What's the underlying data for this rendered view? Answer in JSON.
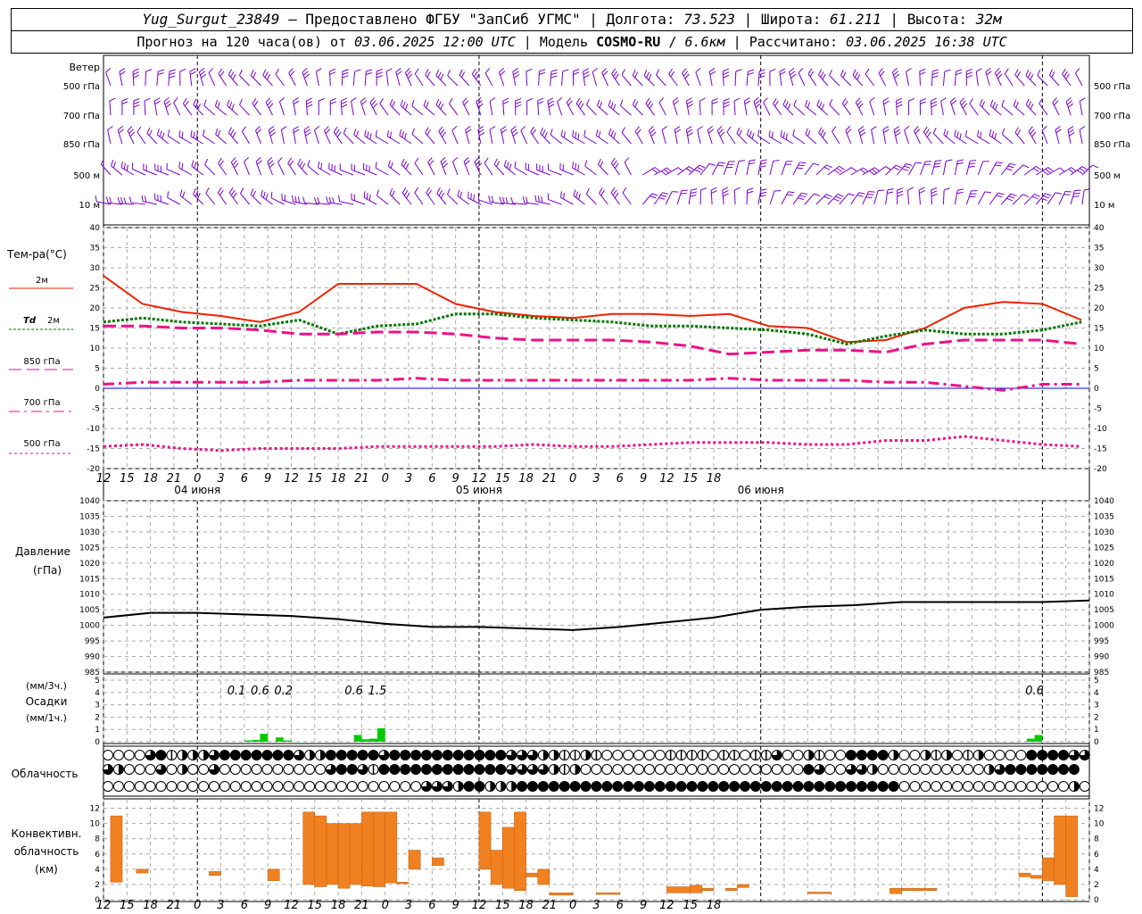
{
  "header": {
    "station": "Yug_Surgut_23849",
    "provider": "Предоставлено ФГБУ \"ЗапСиб УГМС\"",
    "lon_label": "Долгота:",
    "lon_value": "73.523",
    "lat_label": "Широта:",
    "lat_value": "61.211",
    "alt_label": "Высота:",
    "alt_value": "32м",
    "forecast_prefix": "Прогноз на 120 часа(ов) от",
    "forecast_start": "03.06.2025 12:00 UTC",
    "model_label": "Модель",
    "model_name": "COSMO-RU",
    "model_res": "6.6км",
    "computed_label": "Рассчитано:",
    "computed_value": "03.06.2025 16:38 UTC"
  },
  "time_axis": {
    "hour_labels": [
      "12",
      "15",
      "18",
      "21",
      "0",
      "3",
      "6",
      "9",
      "12",
      "15",
      "18",
      "21",
      "0",
      "3",
      "6",
      "9",
      "12",
      "15",
      "18",
      "21",
      "0",
      "3",
      "6",
      "9",
      "12",
      "15",
      "18"
    ],
    "date_labels": [
      "04 июня",
      "05 июня",
      "06 июня"
    ],
    "step_hours": 1
  },
  "labels": {
    "wind_title": "Ветер",
    "wind_levels": [
      "500 гПа",
      "700 гПа",
      "850 гПа",
      "500  м",
      "10   м"
    ],
    "temp_title": "Тем-ра(°C)",
    "legend_2m": "2м",
    "legend_td": "Td",
    "legend_td_2m": "2м",
    "legend_850": "850 гПа",
    "legend_700": "700 гПа",
    "legend_500": "500 гПа",
    "pressure_title": "Давление",
    "pressure_unit": "(гПа)",
    "precip_unit_3h": "(мм/3ч.)",
    "precip_title": "Осадки",
    "precip_unit_1h": "(мм/1ч.)",
    "cloud_title": "Облачность",
    "conv_title_1": "Конвективн.",
    "conv_title_2": "облачность",
    "conv_unit": "(км)"
  },
  "colors": {
    "wind": "#7700cc",
    "t2m": "#ee2200",
    "td2m": "#007700",
    "t_upper": "#ee1188",
    "pressure": "#000000",
    "precip": "#00cc00",
    "conv": "#f08020",
    "grid": "#aaaaaa",
    "zero_line": "#0000ff"
  },
  "chart_data": [
    {
      "type": "line",
      "name": "temperature",
      "x_hours": [
        0,
        3,
        6,
        9,
        12,
        15,
        18,
        21,
        24,
        27,
        30,
        33,
        36,
        39,
        42,
        45,
        48,
        51,
        54,
        57,
        60,
        63,
        66,
        69,
        72,
        75,
        78,
        81,
        84,
        87,
        90,
        93,
        96,
        99,
        102,
        105,
        108,
        111,
        114,
        117,
        120
      ],
      "ylim": [
        -20,
        40
      ],
      "yticks": [
        -20,
        -15,
        -10,
        -5,
        0,
        5,
        10,
        15,
        20,
        25,
        30,
        35,
        40
      ],
      "series": [
        {
          "name": "2м",
          "values": [
            28,
            21,
            19,
            18,
            16.5,
            19,
            26,
            26,
            26,
            21,
            19,
            18,
            17.5,
            18.5,
            18.5,
            18,
            18.5,
            15.5,
            15,
            11.5,
            12,
            15,
            20,
            21.5,
            21,
            17
          ]
        },
        {
          "name": "Td 2м",
          "values": [
            16.5,
            17.5,
            16.5,
            16,
            15.5,
            17,
            13.5,
            15.5,
            16,
            18.5,
            18.5,
            17.5,
            17,
            16.5,
            15.5,
            15.5,
            15,
            14.5,
            13.5,
            11,
            13,
            14.5,
            13.5,
            13.5,
            14.5,
            16.5
          ]
        },
        {
          "name": "850 гПа",
          "values": [
            15.5,
            15.5,
            15,
            15,
            14.5,
            13.5,
            13.5,
            14,
            14,
            13.5,
            12.5,
            12,
            12,
            12,
            11.5,
            10.5,
            8.5,
            9,
            9.5,
            9.5,
            9,
            11,
            12,
            12,
            12,
            11
          ]
        },
        {
          "name": "700 гПа",
          "values": [
            1,
            1.5,
            1.5,
            1.5,
            1.5,
            2,
            2,
            2,
            2.5,
            2,
            2,
            2,
            2,
            2,
            2,
            2,
            2.5,
            2,
            2,
            2,
            1.5,
            1.5,
            0.5,
            -0.5,
            1,
            1
          ]
        },
        {
          "name": "500 гПа",
          "values": [
            -14.5,
            -14,
            -15,
            -15.5,
            -15,
            -15,
            -15,
            -14.5,
            -14.5,
            -14.5,
            -14.5,
            -14,
            -14.5,
            -14.5,
            -14,
            -13.5,
            -13.5,
            -13.5,
            -14,
            -14,
            -13,
            -13,
            -12,
            -13,
            -14,
            -14.5
          ]
        }
      ],
      "x_series_hours": [
        0,
        5,
        10,
        15,
        20,
        25,
        30,
        35,
        40,
        45,
        50,
        55,
        60,
        65,
        70,
        75,
        80,
        85,
        90,
        95,
        100,
        105,
        110,
        115,
        120,
        125
      ]
    },
    {
      "type": "line",
      "name": "pressure",
      "ylim": [
        985,
        1040
      ],
      "yticks": [
        985,
        990,
        995,
        1000,
        1005,
        1010,
        1015,
        1020,
        1025,
        1030,
        1035,
        1040
      ],
      "x_hours": [
        0,
        6,
        12,
        18,
        24,
        30,
        36,
        42,
        48,
        54,
        60,
        66,
        72,
        78,
        84,
        90,
        96,
        102,
        108,
        114,
        120,
        126
      ],
      "values": [
        1002.5,
        1004,
        1004,
        1003.5,
        1003,
        1002,
        1000.5,
        999.5,
        999.5,
        999,
        998.5,
        999.5,
        1001,
        1002.5,
        1005,
        1006,
        1006.5,
        1007.5,
        1007.5,
        1007.5,
        1007.5,
        1008
      ]
    },
    {
      "type": "bar",
      "name": "precipitation",
      "ylim": [
        0,
        5
      ],
      "yticks": [
        0,
        1,
        2,
        3,
        4,
        5
      ],
      "bars_1h": [
        {
          "hour": 18,
          "value": 0.1
        },
        {
          "hour": 19,
          "value": 0.15
        },
        {
          "hour": 20,
          "value": 0.65
        },
        {
          "hour": 22,
          "value": 0.35
        },
        {
          "hour": 23,
          "value": 0.1
        },
        {
          "hour": 32,
          "value": 0.55
        },
        {
          "hour": 33,
          "value": 0.2
        },
        {
          "hour": 34,
          "value": 0.25
        },
        {
          "hour": 35,
          "value": 1.1
        },
        {
          "hour": 118,
          "value": 0.25
        },
        {
          "hour": 119,
          "value": 0.55
        }
      ],
      "labels_3h": [
        {
          "hour": 17,
          "text": "0.1"
        },
        {
          "hour": 20,
          "text": "0.6"
        },
        {
          "hour": 23,
          "text": "0.2"
        },
        {
          "hour": 32,
          "text": "0.6"
        },
        {
          "hour": 35,
          "text": "1.5"
        },
        {
          "hour": 119,
          "text": "0.6"
        }
      ]
    },
    {
      "type": "table",
      "name": "cloudiness",
      "rows": [
        "upper",
        "middle",
        "lower"
      ],
      "cover_0_to_4": {
        "upper": [
          0,
          0,
          0,
          0,
          3,
          4,
          1,
          2,
          2,
          2,
          3,
          4,
          4,
          4,
          4,
          4,
          4,
          4,
          3,
          2,
          2,
          4,
          4,
          4,
          4,
          4,
          3,
          4,
          4,
          4,
          4,
          4,
          4,
          4,
          4,
          4,
          4,
          4,
          3,
          3,
          3,
          2,
          2,
          1,
          1,
          2,
          1,
          0,
          0,
          0,
          0,
          0,
          0,
          1,
          1,
          1,
          1,
          0,
          1,
          1,
          0,
          1,
          1,
          3,
          0,
          0,
          2,
          1,
          0,
          0,
          4,
          4,
          4,
          4,
          2,
          0,
          0,
          2,
          1,
          2,
          0,
          1,
          2,
          0,
          0,
          0,
          0,
          4,
          4,
          4,
          4,
          3,
          3
        ],
        "middle": [
          3,
          2,
          0,
          0,
          0,
          3,
          0,
          2,
          0,
          0,
          3,
          0,
          0,
          0,
          0,
          0,
          0,
          0,
          0,
          0,
          0,
          3,
          4,
          4,
          3,
          1,
          4,
          4,
          4,
          4,
          4,
          4,
          4,
          4,
          4,
          4,
          4,
          4,
          3,
          3,
          3,
          3,
          2,
          1,
          2,
          0,
          0,
          0,
          0,
          0,
          0,
          0,
          0,
          0,
          0,
          0,
          0,
          0,
          0,
          0,
          0,
          0,
          0,
          0,
          0,
          0,
          4,
          3,
          0,
          0,
          3,
          3,
          2,
          0,
          0,
          0,
          0,
          0,
          0,
          0,
          0,
          0,
          0,
          2,
          3,
          4,
          4,
          4,
          4,
          4,
          4,
          4
        ],
        "lower": [
          0,
          0,
          0,
          0,
          0,
          0,
          0,
          0,
          0,
          0,
          0,
          0,
          0,
          0,
          0,
          0,
          0,
          0,
          0,
          0,
          0,
          0,
          0,
          0,
          0,
          0,
          0,
          0,
          0,
          0,
          3,
          3,
          3,
          2,
          4,
          4,
          2,
          2,
          2,
          4,
          4,
          4,
          4,
          4,
          4,
          4,
          4,
          4,
          4,
          4,
          4,
          4,
          4,
          4,
          4,
          4,
          4,
          4,
          4,
          4,
          4,
          4,
          4,
          4,
          4,
          4,
          4,
          4,
          4,
          4,
          4,
          4,
          4,
          4,
          4,
          0,
          0,
          0,
          0,
          0,
          0,
          0,
          0,
          0,
          0,
          0,
          0,
          0,
          0,
          0,
          0,
          2,
          0,
          4,
          4
        ]
      }
    },
    {
      "type": "bar",
      "name": "convective_cloud",
      "ylim": [
        0,
        13
      ],
      "yticks": [
        0,
        2,
        4,
        6,
        8,
        10,
        12
      ],
      "ranges": [
        {
          "h0": 0.6,
          "h1": 1.6,
          "base": 2.3,
          "top": 11
        },
        {
          "h0": 2.8,
          "h1": 3.8,
          "base": 3.5,
          "top": 4
        },
        {
          "h0": 9,
          "h1": 10,
          "base": 3.2,
          "top": 3.7
        },
        {
          "h0": 14,
          "h1": 15,
          "base": 2.5,
          "top": 4
        },
        {
          "h0": 17,
          "h1": 18,
          "base": 2,
          "top": 11.5
        },
        {
          "h0": 18,
          "h1": 19,
          "base": 1.7,
          "top": 11
        },
        {
          "h0": 19,
          "h1": 20,
          "base": 2,
          "top": 10
        },
        {
          "h0": 20,
          "h1": 21,
          "base": 1.5,
          "top": 10
        },
        {
          "h0": 21,
          "h1": 22,
          "base": 2,
          "top": 10
        },
        {
          "h0": 22,
          "h1": 23,
          "base": 1.8,
          "top": 11.5
        },
        {
          "h0": 23,
          "h1": 24,
          "base": 1.7,
          "top": 11.5
        },
        {
          "h0": 24,
          "h1": 25,
          "base": 2.2,
          "top": 11.5
        },
        {
          "h0": 25,
          "h1": 26,
          "base": 2.1,
          "top": 2.3
        },
        {
          "h0": 26,
          "h1": 27,
          "base": 4,
          "top": 6.5
        },
        {
          "h0": 28,
          "h1": 29,
          "base": 4.5,
          "top": 5.5
        },
        {
          "h0": 32,
          "h1": 33,
          "base": 4,
          "top": 11.5
        },
        {
          "h0": 33,
          "h1": 34,
          "base": 2,
          "top": 6.5
        },
        {
          "h0": 34,
          "h1": 35,
          "base": 1.5,
          "top": 9.5
        },
        {
          "h0": 35,
          "h1": 36,
          "base": 1.2,
          "top": 11.5
        },
        {
          "h0": 36,
          "h1": 37,
          "base": 3,
          "top": 3.5
        },
        {
          "h0": 37,
          "h1": 38,
          "base": 2,
          "top": 4
        },
        {
          "h0": 38,
          "h1": 40,
          "base": 0.6,
          "top": 0.9
        },
        {
          "h0": 42,
          "h1": 44,
          "base": 0.7,
          "top": 0.9
        },
        {
          "h0": 48,
          "h1": 50,
          "base": 0.9,
          "top": 1.7
        },
        {
          "h0": 50,
          "h1": 51,
          "base": 0.9,
          "top": 1.9
        },
        {
          "h0": 51,
          "h1": 52,
          "base": 1.2,
          "top": 1.5
        },
        {
          "h0": 53,
          "h1": 54,
          "base": 1.2,
          "top": 1.5
        },
        {
          "h0": 54,
          "h1": 55,
          "base": 1.6,
          "top": 2
        },
        {
          "h0": 60,
          "h1": 62,
          "base": 0.8,
          "top": 1
        },
        {
          "h0": 67,
          "h1": 68,
          "base": 0.8,
          "top": 1.5
        },
        {
          "h0": 68,
          "h1": 71,
          "base": 1.2,
          "top": 1.5
        },
        {
          "h0": 78,
          "h1": 79,
          "base": 3,
          "top": 3.5
        },
        {
          "h0": 79,
          "h1": 80,
          "base": 2.8,
          "top": 3.2
        },
        {
          "h0": 80,
          "h1": 81,
          "base": 2.5,
          "top": 5.5
        },
        {
          "h0": 81,
          "h1": 82,
          "base": 2,
          "top": 11
        },
        {
          "h0": 82,
          "h1": 83,
          "base": 0.4,
          "top": 11
        }
      ]
    }
  ],
  "wind_glyphs": {
    "rows": 5,
    "columns": 85
  }
}
